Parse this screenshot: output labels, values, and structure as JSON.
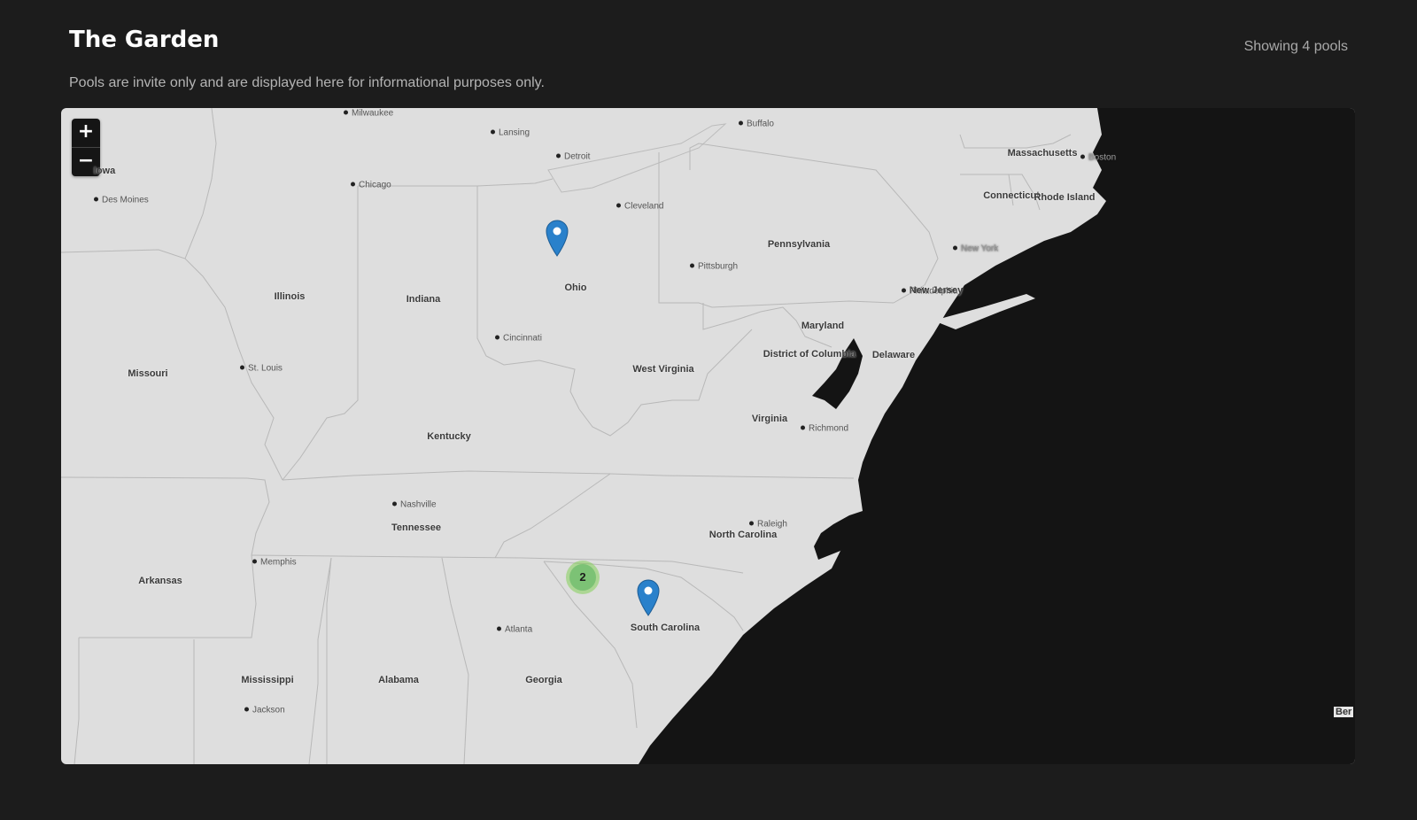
{
  "header": {
    "title": "The Garden",
    "subtitle": "Pools are invite only and are displayed here for informational purposes only.",
    "pool_count": "Showing 4 pools"
  },
  "map": {
    "zoom_in": "+",
    "zoom_out": "−",
    "states": [
      "Iowa",
      "Illinois",
      "Indiana",
      "Ohio",
      "Pennsylvania",
      "Missouri",
      "West Virginia",
      "Maryland",
      "District of Columbia",
      "Delaware",
      "New Jersey",
      "Kentucky",
      "Virginia",
      "Tennessee",
      "North Carolina",
      "Arkansas",
      "Mississippi",
      "Alabama",
      "Georgia",
      "South Carolina",
      "Massachusetts",
      "Connecticut",
      "Rhode Island"
    ],
    "cities": [
      "Milwaukee",
      "Lansing",
      "Buffalo",
      "Detroit",
      "Chicago",
      "Des Moines",
      "Cleveland",
      "Pittsburgh",
      "New York",
      "Philadelphia",
      "Boston",
      "Cincinnati",
      "St. Louis",
      "Richmond",
      "Nashville",
      "Raleigh",
      "Memphis",
      "Atlanta",
      "Jackson"
    ],
    "edge_label": "Ber",
    "cluster_count": "2",
    "colors": {
      "land": "#dedede",
      "water": "#141414",
      "marker": "#2a81cb",
      "cluster": "#7cc275"
    }
  }
}
